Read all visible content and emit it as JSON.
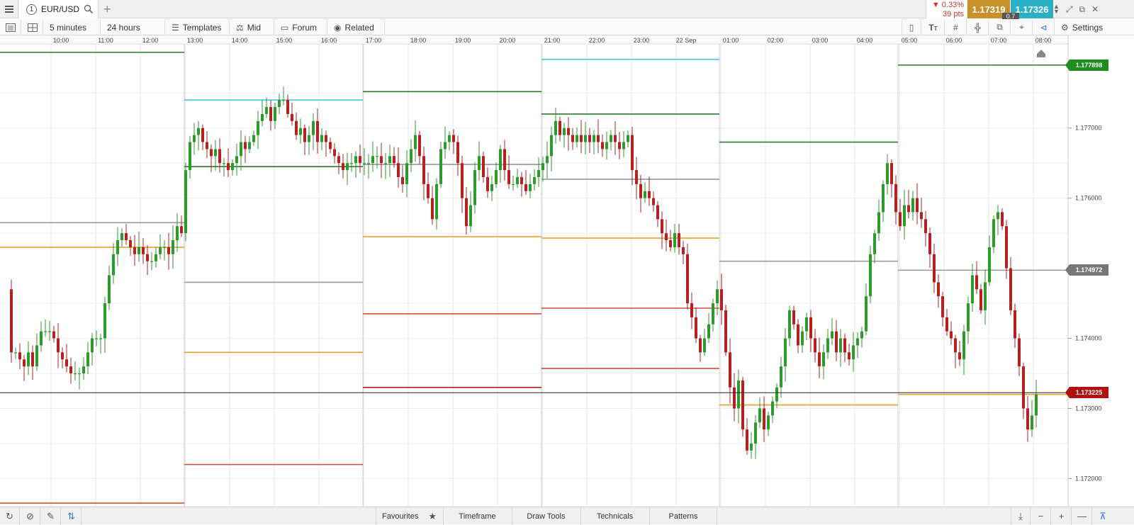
{
  "tab": {
    "number": "1",
    "instrument": "EUR/USD"
  },
  "quote": {
    "change_pct": "▼ 0.33%",
    "change_pts": "39 pts",
    "bid": "1.17319",
    "ask": "1.17326",
    "spread": "0.7",
    "bid_color": "#c8912a",
    "ask_color": "#2bb0c6",
    "down_color": "#c0392b"
  },
  "toolbar": {
    "interval": "5 minutes",
    "range": "24 hours",
    "templates": "Templates",
    "price_mode": "Mid",
    "forum": "Forum",
    "related": "Related",
    "settings": "Settings"
  },
  "bottom": {
    "favourites": "Favourites",
    "timeframe": "Timeframe",
    "draw_tools": "Draw Tools",
    "technicals": "Technicals",
    "patterns": "Patterns"
  },
  "chart_data": {
    "type": "candlestick",
    "instrument": "EUR/USD",
    "interval": "5 minutes",
    "x_ticks": [
      "10:00",
      "11:00",
      "12:00",
      "13:00",
      "14:00",
      "15:00",
      "16:00",
      "17:00",
      "18:00",
      "19:00",
      "20:00",
      "21:00",
      "22:00",
      "23:00",
      "22 Sep",
      "01:00",
      "02:00",
      "03:00",
      "04:00",
      "05:00",
      "06:00",
      "07:00",
      "08:00"
    ],
    "y_ticks": [
      "1.177000",
      "1.176000",
      "1.174000",
      "1.173000",
      "1.172000"
    ],
    "ylim": [
      1.1716,
      1.1782
    ],
    "current_price": "1.173225",
    "price_tags": [
      {
        "value": "1.177898",
        "color": "#1f8c1f"
      },
      {
        "value": "1.174972",
        "color": "#777777"
      },
      {
        "value": "1.173225",
        "color": "#b01010"
      }
    ],
    "colors": {
      "up": "#2e9a2e",
      "down": "#b52020"
    },
    "close_path": [
      [
        10,
        1.1747
      ],
      [
        16,
        1.1738
      ],
      [
        22,
        1.1738
      ],
      [
        28,
        1.1737
      ],
      [
        34,
        1.1736
      ],
      [
        40,
        1.1738
      ],
      [
        46,
        1.1736
      ],
      [
        52,
        1.1739
      ],
      [
        58,
        1.1741
      ],
      [
        64,
        1.1741
      ],
      [
        70,
        1.1741
      ],
      [
        76,
        1.174
      ],
      [
        82,
        1.1738
      ],
      [
        88,
        1.1737
      ],
      [
        94,
        1.1736
      ],
      [
        100,
        1.1735
      ],
      [
        106,
        1.1735
      ],
      [
        112,
        1.1735
      ],
      [
        118,
        1.1736
      ],
      [
        124,
        1.1738
      ],
      [
        130,
        1.174
      ],
      [
        136,
        1.174
      ],
      [
        142,
        1.174
      ],
      [
        148,
        1.1745
      ],
      [
        154,
        1.1749
      ],
      [
        160,
        1.1752
      ],
      [
        166,
        1.1754
      ],
      [
        172,
        1.1755
      ],
      [
        178,
        1.1754
      ],
      [
        184,
        1.1753
      ],
      [
        190,
        1.1752
      ],
      [
        196,
        1.1753
      ],
      [
        202,
        1.1752
      ],
      [
        208,
        1.1751
      ],
      [
        214,
        1.1751
      ],
      [
        220,
        1.1752
      ],
      [
        226,
        1.1753
      ],
      [
        232,
        1.1753
      ],
      [
        238,
        1.1752
      ],
      [
        244,
        1.1754
      ],
      [
        250,
        1.1756
      ],
      [
        256,
        1.1755
      ],
      [
        262,
        1.1764
      ],
      [
        268,
        1.1768
      ],
      [
        274,
        1.1769
      ],
      [
        280,
        1.177
      ],
      [
        286,
        1.1768
      ],
      [
        292,
        1.1767
      ],
      [
        298,
        1.1766
      ],
      [
        304,
        1.1767
      ],
      [
        310,
        1.1765
      ],
      [
        316,
        1.1765
      ],
      [
        322,
        1.1764
      ],
      [
        328,
        1.1765
      ],
      [
        334,
        1.1766
      ],
      [
        340,
        1.1768
      ],
      [
        346,
        1.1767
      ],
      [
        352,
        1.1768
      ],
      [
        358,
        1.1769
      ],
      [
        364,
        1.1771
      ],
      [
        370,
        1.1772
      ],
      [
        376,
        1.1773
      ],
      [
        382,
        1.1771
      ],
      [
        388,
        1.1773
      ],
      [
        394,
        1.1774
      ],
      [
        400,
        1.1774
      ],
      [
        406,
        1.1772
      ],
      [
        412,
        1.1771
      ],
      [
        418,
        1.1769
      ],
      [
        424,
        1.177
      ],
      [
        430,
        1.1768
      ],
      [
        436,
        1.1769
      ],
      [
        442,
        1.1771
      ],
      [
        448,
        1.1768
      ],
      [
        454,
        1.1769
      ],
      [
        460,
        1.1768
      ],
      [
        466,
        1.1767
      ],
      [
        472,
        1.1766
      ],
      [
        478,
        1.1765
      ],
      [
        484,
        1.1764
      ],
      [
        490,
        1.1765
      ],
      [
        496,
        1.1765
      ],
      [
        502,
        1.1766
      ],
      [
        508,
        1.1765
      ],
      [
        514,
        1.1765
      ],
      [
        520,
        1.1765
      ],
      [
        526,
        1.1766
      ],
      [
        532,
        1.1766
      ],
      [
        538,
        1.1765
      ],
      [
        544,
        1.1765
      ],
      [
        550,
        1.1766
      ],
      [
        556,
        1.1765
      ],
      [
        562,
        1.1763
      ],
      [
        568,
        1.1762
      ],
      [
        574,
        1.1765
      ],
      [
        580,
        1.1767
      ],
      [
        586,
        1.1769
      ],
      [
        592,
        1.1766
      ],
      [
        598,
        1.1762
      ],
      [
        604,
        1.176
      ],
      [
        610,
        1.1757
      ],
      [
        616,
        1.1762
      ],
      [
        622,
        1.1767
      ],
      [
        628,
        1.1768
      ],
      [
        634,
        1.1769
      ],
      [
        640,
        1.1768
      ],
      [
        646,
        1.1765
      ],
      [
        652,
        1.176
      ],
      [
        658,
        1.1756
      ],
      [
        664,
        1.1759
      ],
      [
        670,
        1.1764
      ],
      [
        676,
        1.1766
      ],
      [
        682,
        1.1763
      ],
      [
        688,
        1.1761
      ],
      [
        694,
        1.1762
      ],
      [
        700,
        1.1764
      ],
      [
        706,
        1.1767
      ],
      [
        712,
        1.1764
      ],
      [
        718,
        1.1762
      ],
      [
        724,
        1.1762
      ],
      [
        730,
        1.1763
      ],
      [
        736,
        1.1762
      ],
      [
        742,
        1.1761
      ],
      [
        748,
        1.1762
      ],
      [
        754,
        1.1763
      ],
      [
        760,
        1.1764
      ],
      [
        766,
        1.1765
      ],
      [
        772,
        1.1766
      ],
      [
        778,
        1.1769
      ],
      [
        784,
        1.1771
      ],
      [
        790,
        1.1769
      ],
      [
        796,
        1.177
      ],
      [
        802,
        1.1769
      ],
      [
        808,
        1.1768
      ],
      [
        814,
        1.1769
      ],
      [
        820,
        1.1768
      ],
      [
        826,
        1.1769
      ],
      [
        832,
        1.1768
      ],
      [
        838,
        1.1769
      ],
      [
        844,
        1.1768
      ],
      [
        850,
        1.1767
      ],
      [
        856,
        1.1768
      ],
      [
        862,
        1.1769
      ],
      [
        868,
        1.1768
      ],
      [
        874,
        1.1767
      ],
      [
        880,
        1.1768
      ],
      [
        886,
        1.1769
      ],
      [
        892,
        1.1764
      ],
      [
        898,
        1.1762
      ],
      [
        904,
        1.176
      ],
      [
        910,
        1.1761
      ],
      [
        916,
        1.176
      ],
      [
        922,
        1.1759
      ],
      [
        928,
        1.1757
      ],
      [
        934,
        1.1755
      ],
      [
        940,
        1.1754
      ],
      [
        946,
        1.1753
      ],
      [
        952,
        1.1755
      ],
      [
        958,
        1.1753
      ],
      [
        964,
        1.1752
      ],
      [
        970,
        1.1745
      ],
      [
        976,
        1.1743
      ],
      [
        982,
        1.174
      ],
      [
        988,
        1.1738
      ],
      [
        994,
        1.174
      ],
      [
        1000,
        1.1742
      ],
      [
        1006,
        1.1745
      ],
      [
        1012,
        1.1747
      ],
      [
        1018,
        1.1744
      ],
      [
        1024,
        1.1738
      ],
      [
        1030,
        1.1733
      ],
      [
        1036,
        1.173
      ],
      [
        1042,
        1.1734
      ],
      [
        1048,
        1.1727
      ],
      [
        1054,
        1.1724
      ],
      [
        1060,
        1.1725
      ],
      [
        1066,
        1.1728
      ],
      [
        1072,
        1.173
      ],
      [
        1078,
        1.1727
      ],
      [
        1084,
        1.1729
      ],
      [
        1090,
        1.1731
      ],
      [
        1096,
        1.1733
      ],
      [
        1102,
        1.1736
      ],
      [
        1108,
        1.174
      ],
      [
        1114,
        1.1744
      ],
      [
        1120,
        1.1742
      ],
      [
        1126,
        1.1739
      ],
      [
        1132,
        1.1741
      ],
      [
        1138,
        1.1743
      ],
      [
        1144,
        1.174
      ],
      [
        1150,
        1.1738
      ],
      [
        1156,
        1.1736
      ],
      [
        1162,
        1.1738
      ],
      [
        1168,
        1.174
      ],
      [
        1174,
        1.1741
      ],
      [
        1180,
        1.1738
      ],
      [
        1186,
        1.174
      ],
      [
        1192,
        1.1738
      ],
      [
        1198,
        1.1737
      ],
      [
        1204,
        1.1739
      ],
      [
        1210,
        1.174
      ],
      [
        1216,
        1.1741
      ],
      [
        1222,
        1.1746
      ],
      [
        1228,
        1.1752
      ],
      [
        1234,
        1.1755
      ],
      [
        1240,
        1.1758
      ],
      [
        1246,
        1.1762
      ],
      [
        1252,
        1.1765
      ],
      [
        1258,
        1.1762
      ],
      [
        1264,
        1.1758
      ],
      [
        1270,
        1.1756
      ],
      [
        1276,
        1.1759
      ],
      [
        1282,
        1.1758
      ],
      [
        1288,
        1.176
      ],
      [
        1294,
        1.1758
      ],
      [
        1300,
        1.1757
      ],
      [
        1306,
        1.1755
      ],
      [
        1312,
        1.1752
      ],
      [
        1318,
        1.1748
      ],
      [
        1324,
        1.1746
      ],
      [
        1330,
        1.1743
      ],
      [
        1336,
        1.1741
      ],
      [
        1342,
        1.174
      ],
      [
        1348,
        1.1738
      ],
      [
        1354,
        1.1737
      ],
      [
        1360,
        1.1741
      ],
      [
        1366,
        1.1745
      ],
      [
        1372,
        1.1749
      ],
      [
        1378,
        1.1747
      ],
      [
        1384,
        1.1744
      ],
      [
        1390,
        1.1748
      ],
      [
        1396,
        1.1753
      ],
      [
        1402,
        1.1757
      ],
      [
        1408,
        1.1758
      ],
      [
        1414,
        1.1756
      ],
      [
        1420,
        1.175
      ],
      [
        1426,
        1.1744
      ],
      [
        1432,
        1.174
      ],
      [
        1438,
        1.1736
      ],
      [
        1444,
        1.173
      ],
      [
        1450,
        1.1727
      ],
      [
        1456,
        1.1729
      ],
      [
        1462,
        1.1732
      ]
    ],
    "session_levels": [
      {
        "from": 0,
        "to": 260,
        "values": [
          {
            "v": 1.17808,
            "c": "#2a7a2a"
          },
          {
            "v": 1.17565,
            "c": "#999"
          },
          {
            "v": 1.1753,
            "c": "#e8a030"
          },
          {
            "v": 1.17165,
            "c": "#d05030"
          }
        ]
      },
      {
        "from": 260,
        "to": 512,
        "values": [
          {
            "v": 1.1774,
            "c": "#46c8e8"
          },
          {
            "v": 1.17645,
            "c": "#2a7a2a"
          },
          {
            "v": 1.1748,
            "c": "#999"
          },
          {
            "v": 1.1738,
            "c": "#e8a030"
          },
          {
            "v": 1.1722,
            "c": "#d05030"
          }
        ]
      },
      {
        "from": 512,
        "to": 764,
        "values": [
          {
            "v": 1.17752,
            "c": "#2a7a2a"
          },
          {
            "v": 1.17648,
            "c": "#999"
          },
          {
            "v": 1.17545,
            "c": "#e8a030"
          },
          {
            "v": 1.17435,
            "c": "#d05030"
          },
          {
            "v": 1.1733,
            "c": "#b52020"
          }
        ]
      },
      {
        "from": 764,
        "to": 1015,
        "values": [
          {
            "v": 1.17798,
            "c": "#46c8e8"
          },
          {
            "v": 1.1772,
            "c": "#2a7a2a"
          },
          {
            "v": 1.17627,
            "c": "#999"
          },
          {
            "v": 1.17543,
            "c": "#e8a030"
          },
          {
            "v": 1.17443,
            "c": "#d05030"
          },
          {
            "v": 1.17357,
            "c": "#d05030"
          }
        ]
      },
      {
        "from": 1015,
        "to": 1267,
        "values": [
          {
            "v": 1.1768,
            "c": "#2a7a2a"
          },
          {
            "v": 1.1751,
            "c": "#999"
          },
          {
            "v": 1.17305,
            "c": "#e8a030"
          }
        ]
      },
      {
        "from": 1267,
        "to": 1535,
        "values": [
          {
            "v": 1.177898,
            "c": "#2a7a2a"
          },
          {
            "v": 1.174972,
            "c": "#999"
          },
          {
            "v": 1.1732,
            "c": "#e8a030"
          }
        ]
      }
    ]
  }
}
